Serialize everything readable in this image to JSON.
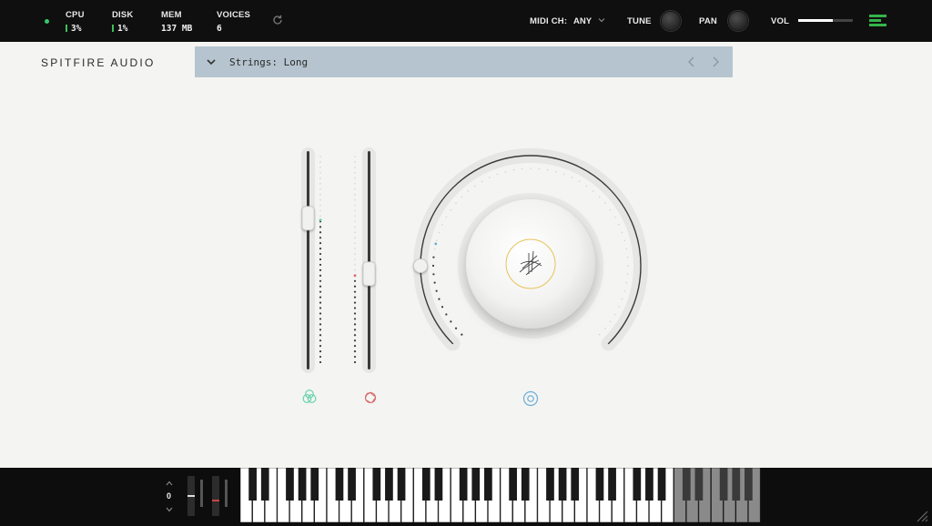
{
  "topbar": {
    "stats": [
      {
        "label": "CPU",
        "value": "3%",
        "bar": true
      },
      {
        "label": "DISK",
        "value": "1%",
        "bar": true
      },
      {
        "label": "MEM",
        "value": "137 MB",
        "bar": false
      },
      {
        "label": "VOICES",
        "value": "6",
        "bar": false
      }
    ],
    "midi_label": "MIDI CH:",
    "midi_value": "ANY",
    "tune_label": "TUNE",
    "pan_label": "PAN",
    "vol_label": "VOL",
    "volume_level": 0.63,
    "colors": {
      "status_green": "#3fbf5a",
      "bar_bg": "#0f0f0f"
    }
  },
  "main": {
    "logo": "SPITFIRE AUDIO",
    "preset": {
      "name": "Strings: Long"
    },
    "colors": {
      "panel_bg": "#f4f4f2",
      "preset_bg": "#b5c4ce"
    },
    "controls": {
      "fader_1": {
        "level": 0.7,
        "icon": "triple-circle-icon",
        "color": "#5fd0a8"
      },
      "fader_2": {
        "level": 0.43,
        "icon": "shutter-icon",
        "color": "#d86a6a"
      },
      "dial": {
        "level": 0.45,
        "icon": "target-icon",
        "color": "#6aaed6",
        "center_icon": "signature-icon",
        "ring_color": "#e8c35a"
      }
    }
  },
  "keyboard": {
    "octave": "0",
    "white_keys": 42,
    "active_white_keys": 35
  }
}
